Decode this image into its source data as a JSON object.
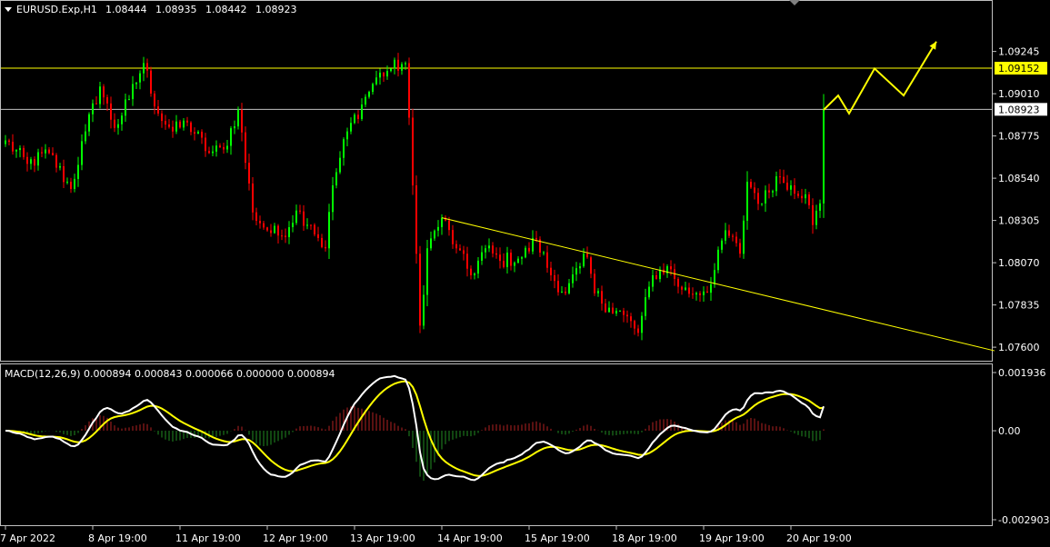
{
  "header": {
    "symbol": "EURUSD.Exp,H1",
    "open": "1.08444",
    "high": "1.08935",
    "low": "1.08442",
    "close": "1.08923"
  },
  "colors": {
    "background": "#000000",
    "frame": "#c0c0c0",
    "bull": "#00ff00",
    "bear": "#ff0000",
    "trend": "#ffff00",
    "level_line": "#ffff00",
    "price_line": "#c0c0c0",
    "arrow": "#ffff00",
    "macd": "#ffffff",
    "signal": "#ffff00",
    "hist_pos": "#b22222",
    "hist_neg": "#228b22",
    "text": "#ffffff"
  },
  "price_axis": {
    "ticks": [
      "1.09245",
      "1.09010",
      "1.08775",
      "1.08540",
      "1.08305",
      "1.08070",
      "1.07835",
      "1.07600"
    ],
    "range": [
      1.0755,
      1.0942
    ]
  },
  "levels": [
    {
      "price": 1.09152,
      "label": "1.09152",
      "kind": "resistance"
    },
    {
      "price": 1.08923,
      "label": "1.08923",
      "kind": "current"
    }
  ],
  "time_axis": {
    "labels": [
      "7 Apr 2022",
      "8 Apr 19:00",
      "11 Apr 19:00",
      "12 Apr 19:00",
      "13 Apr 19:00",
      "14 Apr 19:00",
      "15 Apr 19:00",
      "18 Apr 19:00",
      "19 Apr 19:00",
      "20 Apr 19:00"
    ],
    "label_bars": [
      0,
      24,
      48,
      72,
      96,
      120,
      144,
      168,
      192,
      216
    ]
  },
  "macd": {
    "title": "MACD(12,26,9) 0.000894 0.000843 0.000066 0.000000 0.000894",
    "ticks": [
      "0.001936",
      "0.00",
      "-0.002903"
    ],
    "range": [
      -0.00305,
      0.00215
    ]
  },
  "chart_data": {
    "type": "candlestick",
    "anchors": [
      [
        0,
        1.0875
      ],
      [
        6,
        1.0862
      ],
      [
        12,
        1.0868
      ],
      [
        18,
        1.0848
      ],
      [
        22,
        1.088
      ],
      [
        26,
        1.0905
      ],
      [
        30,
        1.0882
      ],
      [
        34,
        1.0898
      ],
      [
        38,
        1.0918
      ],
      [
        42,
        1.089
      ],
      [
        46,
        1.088
      ],
      [
        50,
        1.0885
      ],
      [
        56,
        1.0868
      ],
      [
        60,
        1.087
      ],
      [
        64,
        1.0892
      ],
      [
        68,
        1.0835
      ],
      [
        72,
        1.0825
      ],
      [
        76,
        1.0822
      ],
      [
        80,
        1.0836
      ],
      [
        84,
        1.0828
      ],
      [
        88,
        1.0815
      ],
      [
        90,
        1.085
      ],
      [
        94,
        1.088
      ],
      [
        98,
        1.0895
      ],
      [
        102,
        1.091
      ],
      [
        106,
        1.0915
      ],
      [
        110,
        1.0918
      ],
      [
        112,
        1.085
      ],
      [
        114,
        1.0772
      ],
      [
        116,
        1.0815
      ],
      [
        120,
        1.0832
      ],
      [
        124,
        1.0815
      ],
      [
        128,
        1.08
      ],
      [
        132,
        1.0815
      ],
      [
        136,
        1.0808
      ],
      [
        142,
        1.081
      ],
      [
        146,
        1.082
      ],
      [
        150,
        1.08
      ],
      [
        154,
        1.079
      ],
      [
        158,
        1.0805
      ],
      [
        160,
        1.081
      ],
      [
        162,
        1.079
      ],
      [
        166,
        1.0782
      ],
      [
        170,
        1.0778
      ],
      [
        174,
        1.0768
      ],
      [
        178,
        1.08
      ],
      [
        182,
        1.0805
      ],
      [
        186,
        1.0792
      ],
      [
        190,
        1.079
      ],
      [
        194,
        1.0795
      ],
      [
        198,
        1.0825
      ],
      [
        202,
        1.0812
      ],
      [
        204,
        1.0852
      ],
      [
        208,
        1.084
      ],
      [
        212,
        1.0855
      ],
      [
        216,
        1.085
      ],
      [
        220,
        1.0845
      ],
      [
        222,
        1.0828
      ],
      [
        224,
        1.084
      ],
      [
        225,
        1.0892
      ]
    ],
    "projection": [
      [
        225,
        1.0892
      ],
      [
        229,
        1.09
      ],
      [
        232,
        1.089
      ],
      [
        239,
        1.0915
      ],
      [
        247,
        1.09
      ],
      [
        256,
        1.093
      ]
    ],
    "trendline": [
      [
        120,
        1.0832
      ],
      [
        272,
        1.0758
      ]
    ]
  }
}
